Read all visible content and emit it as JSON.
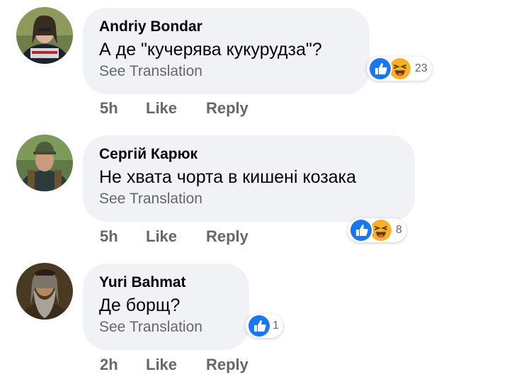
{
  "comments": [
    {
      "author": "Andriy Bondar",
      "text": "А де \"кучерява кукурудза\"?",
      "translation_link": "See Translation",
      "time": "5h",
      "like_label": "Like",
      "reply_label": "Reply",
      "reactions": [
        "like-icon",
        "haha-icon"
      ],
      "reaction_count": "23"
    },
    {
      "author": "Сергій Карюк",
      "text": "Не хвата чорта в кишені козака",
      "translation_link": "See Translation",
      "time": "5h",
      "like_label": "Like",
      "reply_label": "Reply",
      "reactions": [
        "like-icon",
        "haha-icon"
      ],
      "reaction_count": "8"
    },
    {
      "author": "Yuri  Bahmat",
      "text": "Де борщ?",
      "translation_link": "See Translation",
      "time": "2h",
      "like_label": "Like",
      "reply_label": "Reply",
      "reactions": [
        "like-icon"
      ],
      "reaction_count": "1"
    }
  ],
  "colors": {
    "bubble": "#f0f2f5",
    "secondary_text": "#65676b",
    "like_blue": "#1877f2",
    "haha_yellow": "#f7b125"
  }
}
